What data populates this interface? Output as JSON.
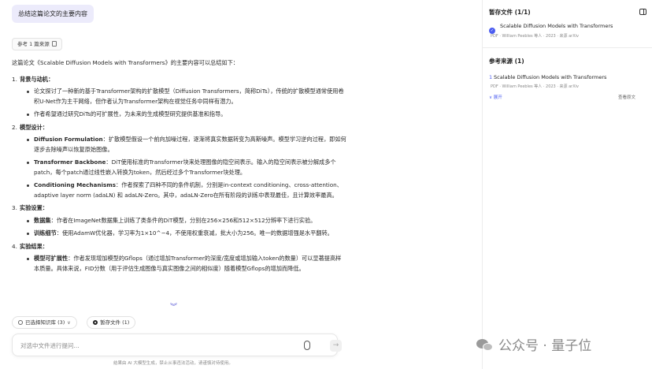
{
  "chat": {
    "user_message": "总结这篇论文的主要内容",
    "ref_chip": "参考 1 篇来源",
    "intro": "这篇论文《Scalable Diffusion Models with Transformers》的主要内容可以总结如下：",
    "sections": [
      {
        "num": "1.",
        "title": "背景与动机：",
        "items": [
          {
            "term": "",
            "text": "论文探讨了一种新的基于Transformer架构的扩散模型（Diffusion Transformers，简称DiTs），传统的扩散模型通常使用卷积U-Net作为主干网络，但作者认为Transformer架构在视觉任务中同样有潜力。"
          },
          {
            "term": "",
            "text": "作者希望通过研究DiTs的可扩展性，为未来的生成模型研究提供基准和指导。"
          }
        ]
      },
      {
        "num": "2.",
        "title": "模型设计：",
        "items": [
          {
            "term": "Diffusion Formulation",
            "text": "：扩散模型假设一个前向加噪过程，逐渐将真实数据转变为高斯噪声。模型学习逆向过程，即如何逐步去除噪声以恢复原始图像。"
          },
          {
            "term": "Transformer Backbone",
            "text": "：DiT使用标准的Transformer块来处理图像的隐空间表示。输入的隐空间表示被分解成多个patch，每个patch通过线性嵌入转换为token，然后经过多个Transformer块处理。"
          },
          {
            "term": "Conditioning Mechanisms",
            "text": "：作者探索了四种不同的条件机制，分别是in-context conditioning、cross-attention、adaptive layer norm (adaLN) 和 adaLN-Zero。其中，adaLN-Zero在所有阶段的训练中表现最佳，且计算效率最高。"
          }
        ]
      },
      {
        "num": "3.",
        "title": "实验设置：",
        "items": [
          {
            "term": "数据集",
            "text": "：作者在ImageNet数据集上训练了类条件的DiT模型，分别在256×256和512×512分辨率下进行实验。"
          },
          {
            "term": "训练细节",
            "text": "：使用AdamW优化器，学习率为1×10^−4，不使用权重衰减，批大小为256。唯一的数据增强是水平翻转。"
          }
        ]
      },
      {
        "num": "4.",
        "title": "实验结果：",
        "items": [
          {
            "term": "模型可扩展性",
            "text": "：作者发现增加模型的Gflops（通过增加Transformer的深度/宽度或增加输入token的数量）可以显著提高样本质量。具体来说，FID分数（用于评估生成图像与真实图像之间的相似度）随着模型Gflops的增加而降低。"
          }
        ]
      }
    ],
    "scroll_down_glyph": "︾",
    "pills": {
      "knowledge": "已选择知识库 (3)",
      "temp_files": "暂存文件 (1)"
    },
    "input_placeholder": "对选中文件进行提问...",
    "send_glyph": "→",
    "disclaimer": "结果由 AI 大模型生成，禁止从事违法活动，请谨慎对待使用。"
  },
  "sidebar": {
    "temp_title": "暂存文件 (1/1)",
    "temp_file": {
      "check_glyph": "✓",
      "title": "Scalable Diffusion Models with Transformers",
      "meta": "PDF · William Peebles 等人 · 2023 · 来源 arXiv"
    },
    "ref_title": "参考来源 (1)",
    "ref_source": {
      "num": "1",
      "title": "Scalable Diffusion Models with Transformers",
      "meta": "PDF · William Peebles 等人 · 2023 · 来源 arXiv",
      "expand_label": "∨ 展开",
      "view_label": "查看原文"
    }
  },
  "watermark": "公众号 · 量子位"
}
